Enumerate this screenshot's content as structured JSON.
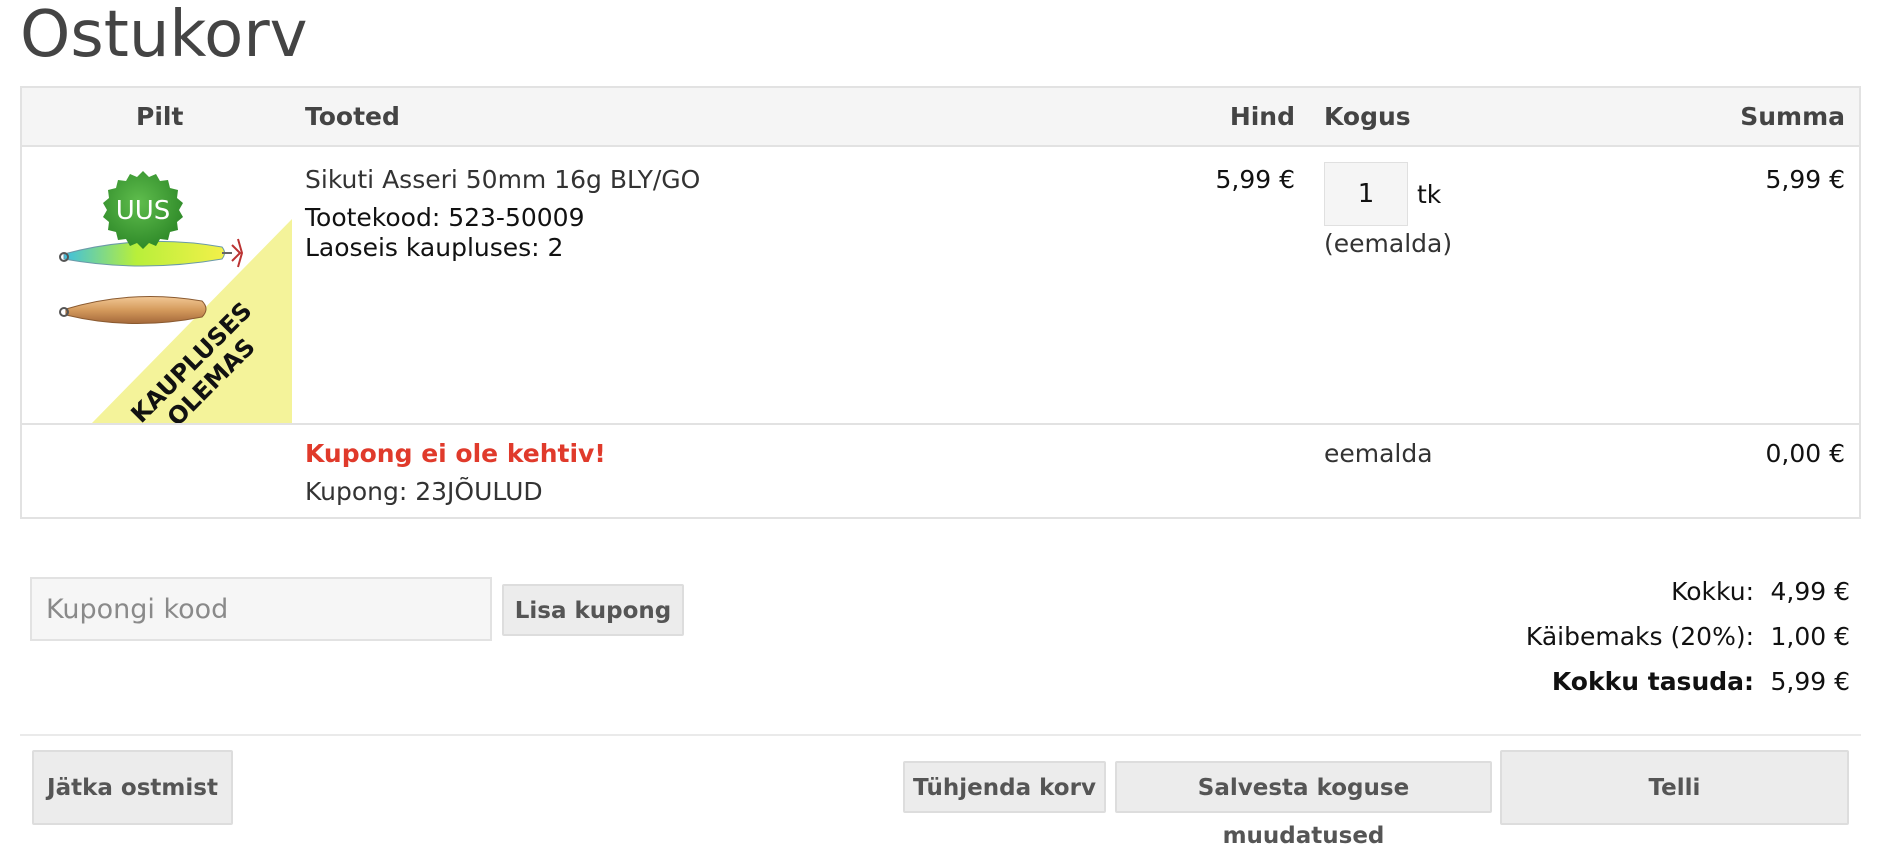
{
  "page": {
    "title": "Ostukorv"
  },
  "table": {
    "headers": {
      "image": "Pilt",
      "products": "Tooted",
      "price": "Hind",
      "quantity": "Kogus",
      "sum": "Summa"
    }
  },
  "product": {
    "badge": "UUS",
    "banner": [
      "KAUPLUSES",
      "OLEMAS"
    ],
    "name": "Sikuti Asseri 50mm 16g BLY/GO",
    "code": "Tootekood: 523-50009",
    "stock": "Laoseis kaupluses: 2",
    "price": "5,99 €",
    "quantity": "1",
    "unit": "tk",
    "remove": "(eemalda)",
    "sum": "5,99 €"
  },
  "coupon_row": {
    "error": "Kupong ei ole kehtiv!",
    "coupon": "Kupong: 23JÕULUD",
    "remove": "eemalda",
    "sum": "0,00 €"
  },
  "coupon_form": {
    "placeholder": "Kupongi kood",
    "button": "Lisa kupong"
  },
  "totals": {
    "subtotal_label": "Kokku:",
    "subtotal": "4,99 €",
    "vat_label": "Käibemaks (20%):",
    "vat": "1,00 €",
    "total_label": "Kokku tasuda:",
    "total": "5,99 €"
  },
  "actions": {
    "continue": "Jätka ostmist",
    "empty": "Tühjenda korv",
    "save": "Salvesta koguse muudatused",
    "order": "Telli"
  },
  "colors": {
    "error": "#e03a2b",
    "badge": "#3c9a35",
    "banner": "#f4f39a"
  }
}
